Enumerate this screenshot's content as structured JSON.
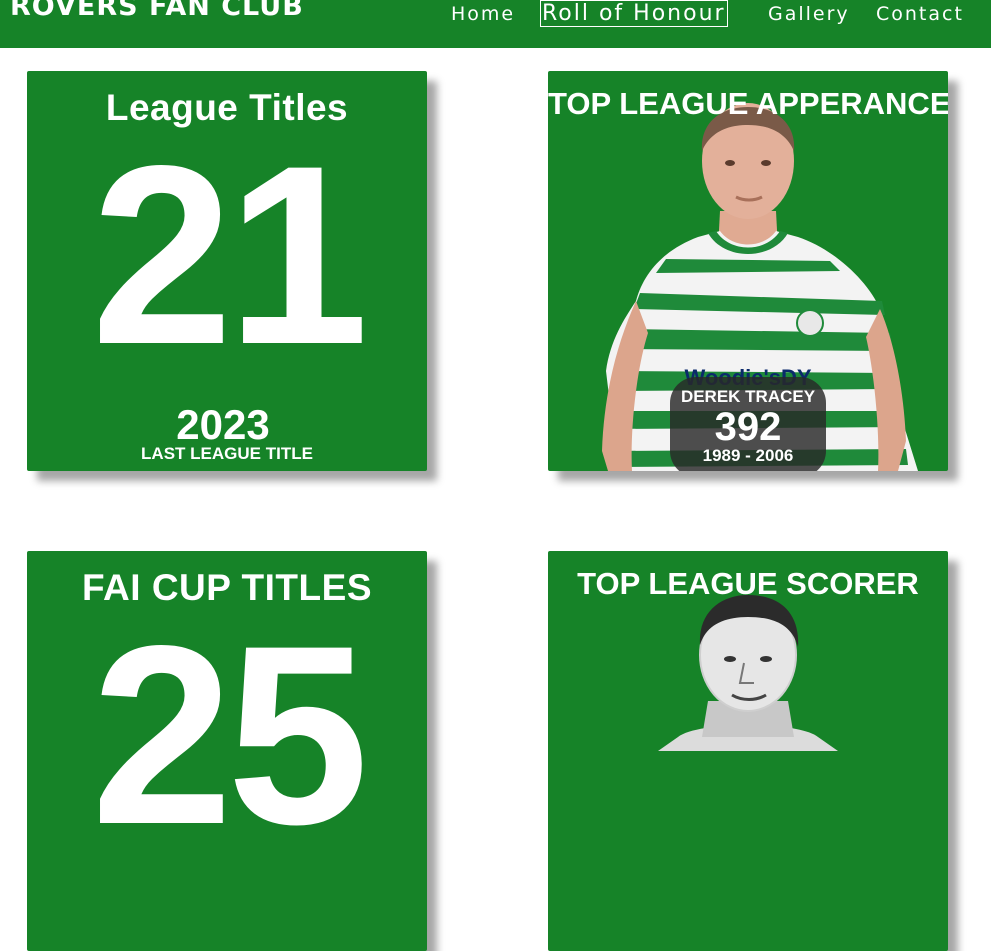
{
  "header": {
    "brand": "ROVERS FAN CLUB",
    "nav": [
      {
        "label": "Home",
        "active": false
      },
      {
        "label": "Roll of Honour",
        "active": true
      },
      {
        "label": "Gallery",
        "active": false
      },
      {
        "label": "Contact",
        "active": false
      }
    ]
  },
  "colors": {
    "brand_green": "#168328",
    "text": "#ffffff",
    "badge_bg": "#282828"
  },
  "cards": {
    "league": {
      "title": "League Titles",
      "count": "21",
      "year": "2023",
      "subtitle": "LAST LEAGUE TITLE"
    },
    "appearance": {
      "title": "TOP LEAGUE APPERANCE",
      "player": "DEREK TRACEY",
      "appearances": "392",
      "years": "1989 - 2006",
      "sponsor": "Woodie'sDY"
    },
    "cup": {
      "title": "FAI CUP TITLES",
      "count": "25"
    },
    "scorer": {
      "title": "TOP LEAGUE SCORER"
    }
  }
}
